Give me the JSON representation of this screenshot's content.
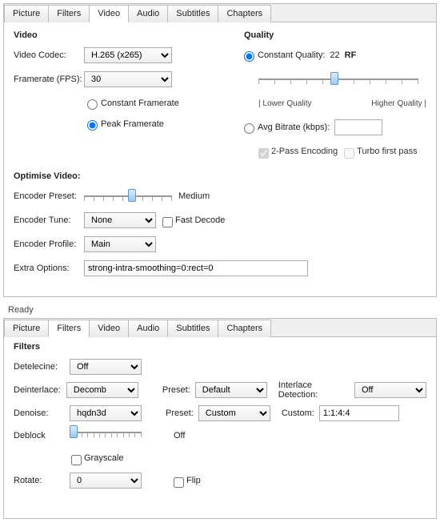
{
  "panel1": {
    "tabs": [
      "Picture",
      "Filters",
      "Video",
      "Audio",
      "Subtitles",
      "Chapters"
    ],
    "activeTab": 2,
    "video": {
      "heading": "Video",
      "codecLabel": "Video Codec:",
      "codecValue": "H.265 (x265)",
      "fpsLabel": "Framerate (FPS):",
      "fpsValue": "30",
      "cfr": "Constant Framerate",
      "pfr": "Peak Framerate"
    },
    "quality": {
      "heading": "Quality",
      "cqLabel": "Constant Quality:",
      "cqValue": "22",
      "cqUnit": "RF",
      "lower": "| Lower Quality",
      "higher": "Higher Quality |",
      "avgLabel": "Avg Bitrate (kbps):",
      "pass2": "2-Pass Encoding",
      "turbo": "Turbo first pass"
    },
    "optimise": {
      "heading": "Optimise Video:",
      "presetLabel": "Encoder Preset:",
      "presetValue": "Medium",
      "tuneLabel": "Encoder Tune:",
      "tuneValue": "None",
      "fastDecode": "Fast Decode",
      "profileLabel": "Encoder Profile:",
      "profileValue": "Main",
      "extraLabel": "Extra Options:",
      "extraValue": "strong-intra-smoothing=0:rect=0"
    }
  },
  "status": "Ready",
  "panel2": {
    "tabs": [
      "Picture",
      "Filters",
      "Video",
      "Audio",
      "Subtitles",
      "Chapters"
    ],
    "activeTab": 1,
    "filters": {
      "heading": "Filters",
      "detelecineLabel": "Detelecine:",
      "detelecineValue": "Off",
      "deinterlaceLabel": "Deinterlace:",
      "deinterlaceValue": "Decomb",
      "deinterlacePresetLabel": "Preset:",
      "deinterlacePresetValue": "Default",
      "interlaceDetLabel": "Interlace Detection:",
      "interlaceDetValue": "Off",
      "denoiseLabel": "Denoise:",
      "denoiseValue": "hqdn3d",
      "denoisePresetLabel": "Preset:",
      "denoisePresetValue": "Custom",
      "customLabel": "Custom:",
      "customValue": "1:1:4:4",
      "deblockLabel": "Deblock",
      "deblockValue": "Off",
      "grayscale": "Grayscale",
      "rotateLabel": "Rotate:",
      "rotateValue": "0",
      "flip": "Flip"
    }
  }
}
